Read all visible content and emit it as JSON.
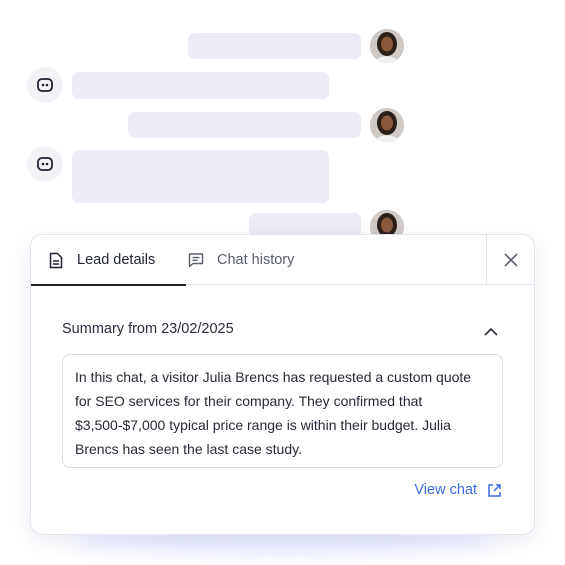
{
  "tabs": {
    "lead_details": "Lead details",
    "chat_history": "Chat history"
  },
  "summary": {
    "heading": "Summary from 23/02/2025",
    "text": "In this chat, a visitor Julia Brencs has requested a custom quote for SEO services for their company. They confirmed that $3,500-$7,000 typical price range is within their budget. Julia Brencs has seen the last case study."
  },
  "actions": {
    "view_chat": "View chat"
  },
  "icons": {
    "lead_tab": "document-icon",
    "chat_tab": "message-icon",
    "close": "close-icon",
    "collapse": "chevron-up-icon",
    "external": "external-link-icon",
    "bot": "bot-icon"
  },
  "colors": {
    "accent": "#3d6ae0",
    "bubble": "#ececf6",
    "text": "#1f2330"
  }
}
